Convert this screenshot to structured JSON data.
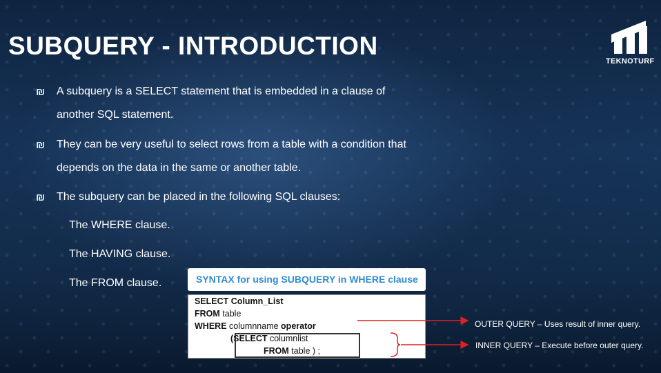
{
  "slide": {
    "title": "SUBQUERY - INTRODUCTION",
    "logo_text": "TEKNOTURF",
    "bullet_glyph": "₪",
    "bullets": [
      {
        "line1": "A subquery is a SELECT statement that is embedded in a clause of",
        "line2": "another SQL statement."
      },
      {
        "line1": "They can be very useful to select rows from a table with a condition that",
        "line2": "depends on the data in the same or another table."
      },
      {
        "line1": "The subquery can be placed in the following SQL clauses:"
      }
    ],
    "clauses": [
      "The WHERE clause.",
      "The HAVING clause.",
      "The FROM clause."
    ],
    "syntax_title": "SYNTAX  for using SUBQUERY in WHERE clause",
    "code": {
      "l1_kw": "SELECT Column_List",
      "l2_kw": "FROM",
      "l2_rest": " table",
      "l3_kw": "WHERE",
      "l3_mid": " columnname ",
      "l3_kw2": "operator",
      "l4_pre": "(",
      "l4_kw": "SELECT",
      "l4_rest": " columnlist",
      "l5_kw": "FROM",
      "l5_rest": " table ) ;"
    },
    "annotations": {
      "outer": "OUTER QUERY – Uses result of inner query.",
      "inner": "INNER QUERY – Execute before outer query."
    },
    "colors": {
      "arrow": "#e02020",
      "syntax_title": "#2e8bd0"
    }
  }
}
